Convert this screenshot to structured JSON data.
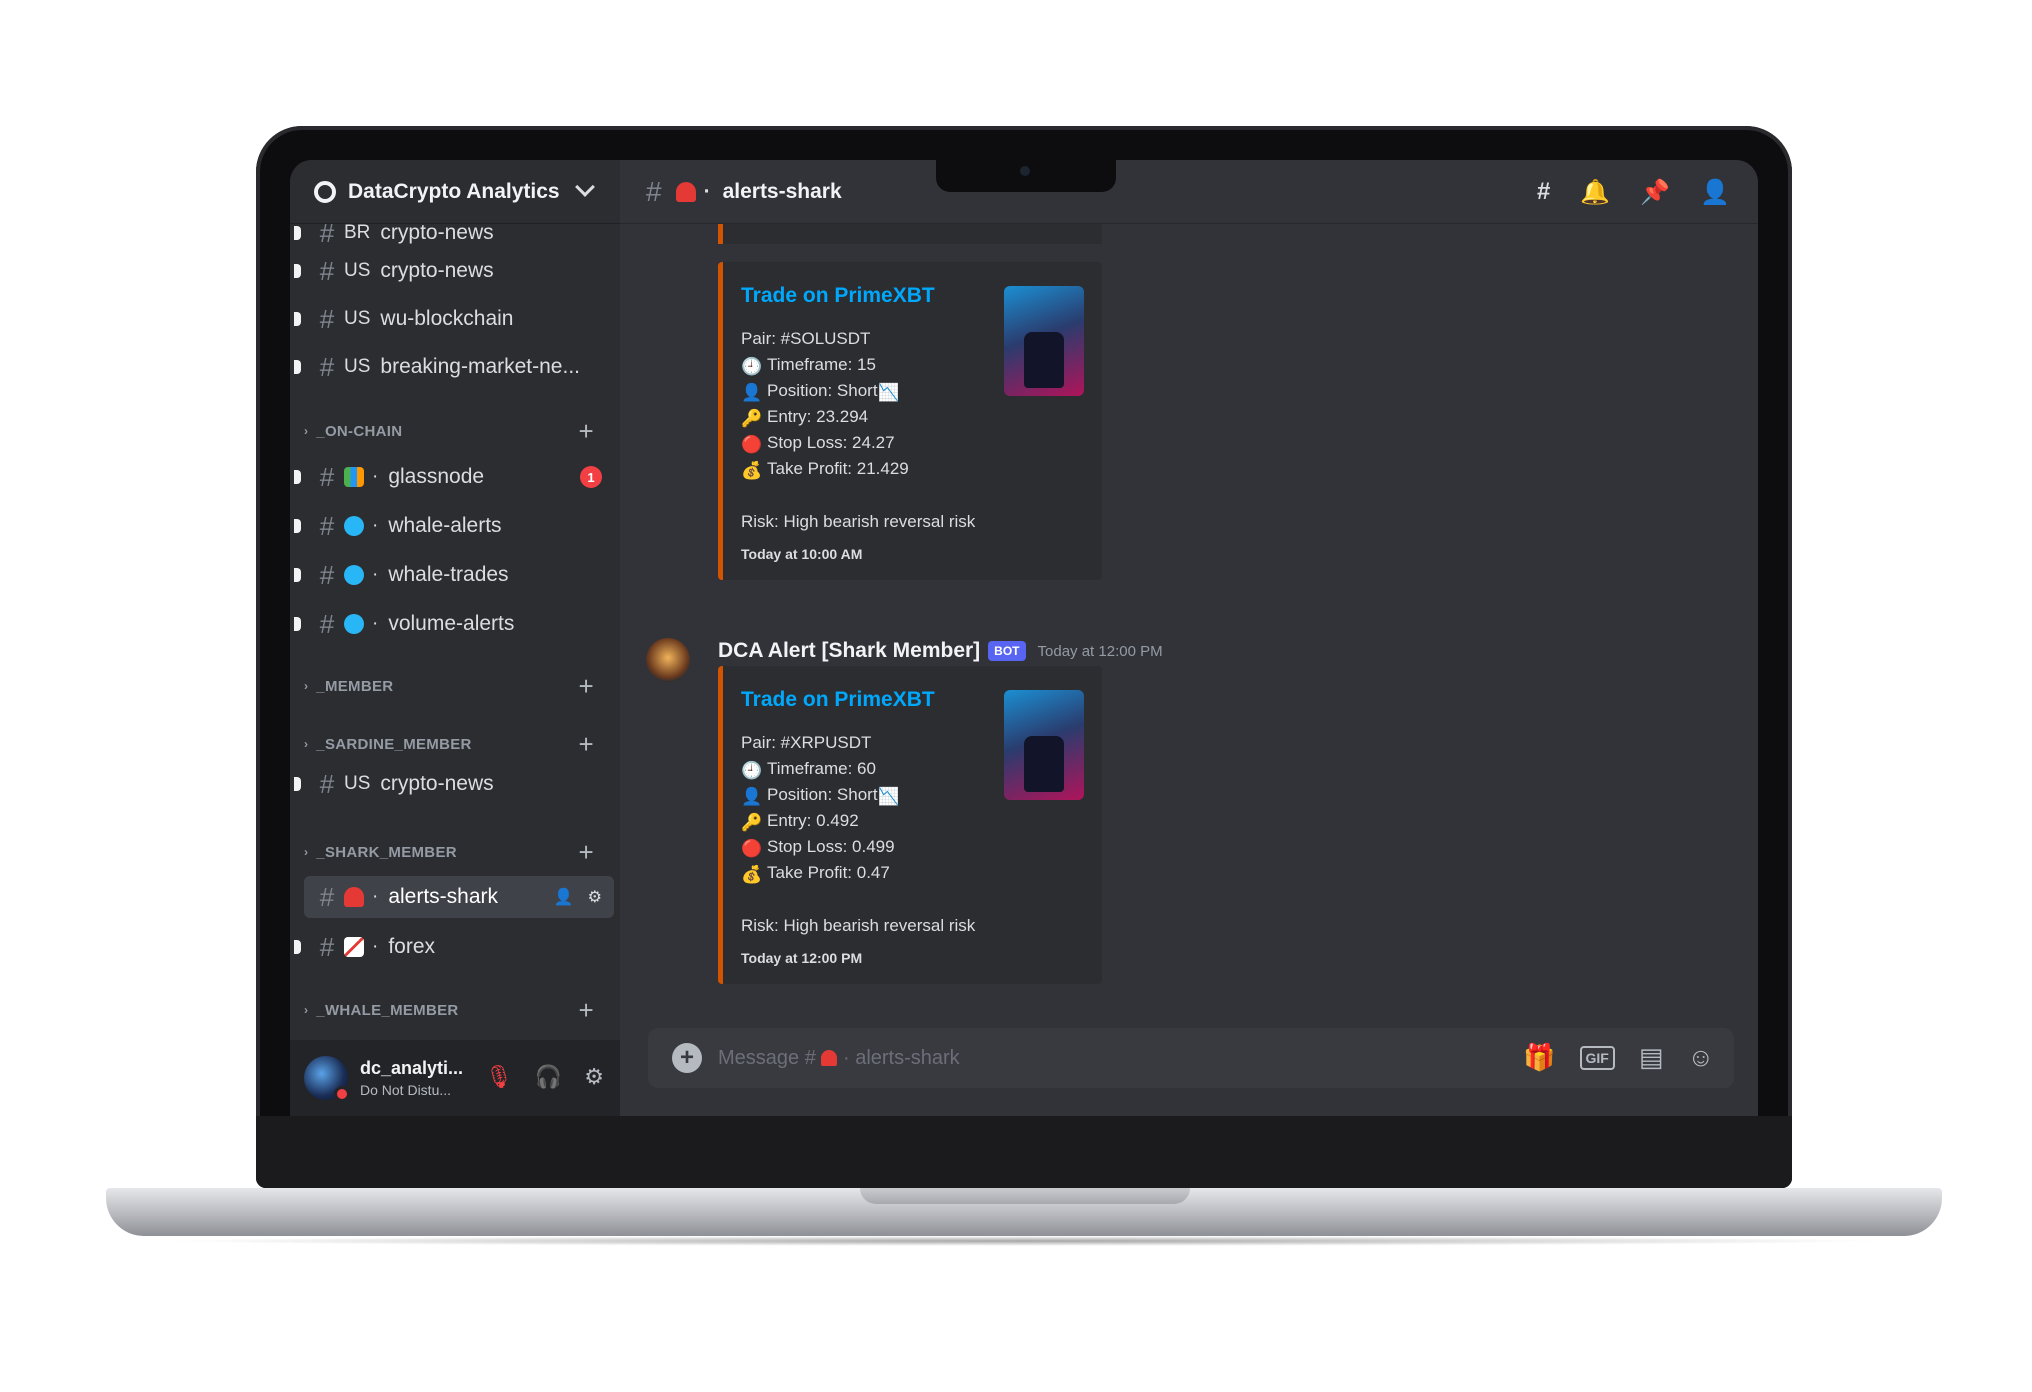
{
  "server": {
    "name": "DataCrypto Analytics"
  },
  "channels_top": [
    {
      "prefix": "BR",
      "name": "crypto-news",
      "partial": true
    },
    {
      "prefix": "US",
      "name": "crypto-news"
    },
    {
      "prefix": "US",
      "name": "wu-blockchain"
    },
    {
      "prefix": "US",
      "name": "breaking-market-ne..."
    }
  ],
  "categories": {
    "on_chain": "_ON-CHAIN",
    "member": "_MEMBER",
    "sardine": "_SARDINE_MEMBER",
    "shark": "_SHARK_MEMBER",
    "whale": "_WHALE_MEMBER"
  },
  "on_chain_channels": [
    {
      "name": "glassnode",
      "badge": "1"
    },
    {
      "name": "whale-alerts"
    },
    {
      "name": "whale-trades"
    },
    {
      "name": "volume-alerts"
    }
  ],
  "sardine_channels": [
    {
      "prefix": "US",
      "name": "crypto-news"
    }
  ],
  "shark_channels": [
    {
      "name": "alerts-shark",
      "active": true
    },
    {
      "name": "forex"
    }
  ],
  "user": {
    "name": "dc_analyti...",
    "status": "Do Not Distu..."
  },
  "topbar": {
    "channel": "alerts-shark",
    "sep": "·"
  },
  "messages": [
    {
      "embed_title": "Trade on PrimeXBT",
      "pair": "Pair: #SOLUSDT",
      "timeframe": "Timeframe: 15",
      "position": "Position: Short",
      "entry": "Entry: 23.294",
      "stop_loss": "Stop Loss: 24.27",
      "take_profit": "Take Profit: 21.429",
      "risk": "Risk: High bearish reversal risk",
      "footer": "Today at 10:00 AM"
    },
    {
      "author": "DCA Alert [Shark Member]",
      "bot_tag": "BOT",
      "time": "Today at 12:00 PM",
      "embed_title": "Trade on PrimeXBT",
      "pair": "Pair: #XRPUSDT",
      "timeframe": "Timeframe: 60",
      "position": "Position: Short",
      "entry": "Entry: 0.492",
      "stop_loss": "Stop Loss: 0.499",
      "take_profit": "Take Profit: 0.47",
      "risk": "Risk: High bearish reversal risk",
      "footer": "Today at 12:00 PM"
    }
  ],
  "composer": {
    "placeholder_prefix": "Message #",
    "placeholder_channel": "alerts-shark",
    "gif_label": "GIF"
  },
  "icons": {
    "hash": "#",
    "plus": "+",
    "gear": "⚙",
    "headphones": "🎧",
    "mute_mic": "🎙",
    "bell": "🔔",
    "pin": "📌",
    "members": "👤",
    "threads": "#",
    "gift": "🎁",
    "sticker": "▤",
    "emoji": "☺",
    "clock": "🕘",
    "position": "👤",
    "chart_down": "📉",
    "entry": "🔑",
    "stop": "🔴",
    "profit": "💰",
    "add_member": "👤"
  },
  "colors": {
    "accent_link": "#00a8fc",
    "embed_border": "#d35400",
    "dnd": "#f23f43",
    "bot_tag": "#5865f2"
  }
}
